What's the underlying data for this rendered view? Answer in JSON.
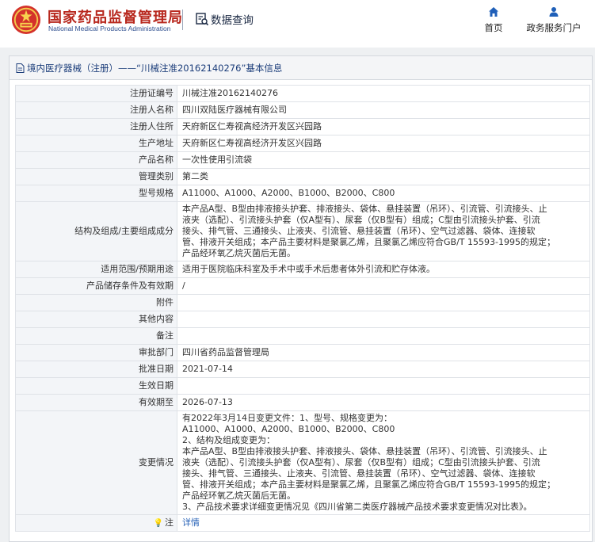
{
  "header": {
    "title_cn": "国家药品监督管理局",
    "title_en": "National Medical Products Administration",
    "data_query": "数据查询",
    "nav": [
      {
        "label": "首页",
        "icon": "home-icon"
      },
      {
        "label": "政务服务门户",
        "icon": "user-icon"
      }
    ]
  },
  "breadcrumb": "境内医疗器械（注册）——“川械注准20162140276”基本信息",
  "rows": {
    "reg_no": {
      "label": "注册证编号",
      "value": "川械注准20162140276"
    },
    "registrant": {
      "label": "注册人名称",
      "value": "四川双陆医疗器械有限公司"
    },
    "registrant_addr": {
      "label": "注册人住所",
      "value": "天府新区仁寿视高经济开发区兴园路"
    },
    "prod_addr": {
      "label": "生产地址",
      "value": "天府新区仁寿视高经济开发区兴园路"
    },
    "product_name": {
      "label": "产品名称",
      "value": "一次性使用引流袋"
    },
    "mgmt_class": {
      "label": "管理类别",
      "value": "第二类"
    },
    "models": {
      "label": "型号规格",
      "value": "A11000、A1000、A2000、B1000、B2000、C800"
    },
    "structure": {
      "label": "结构及组成/主要组成成分",
      "lines": [
        "本产品A型、B型由排液接头护套、排液接头、袋体、悬挂装置（吊环）、引流管、引流接头、止",
        "液夹（选配）、引流接头护套（仅A型有）、尿套（仅B型有）组成；C型由引流接头护套、引流",
        "接头、排气管、三通接头、止液夹、引流管、悬挂装置（吊环）、空气过滤器、袋体、连接软",
        "管、排液开关组成；本产品主要材料是聚氯乙烯，且聚氯乙烯应符合GB/T 15593-1995的规定；",
        "产品经环氧乙烷灭菌后无菌。"
      ]
    },
    "scope": {
      "label": "适用范围/预期用途",
      "value": "适用于医院临床科室及手术中或手术后患者体外引流和贮存体液。"
    },
    "storage": {
      "label": "产品储存条件及有效期",
      "value": "/"
    },
    "attachment": {
      "label": "附件",
      "value": ""
    },
    "other": {
      "label": "其他内容",
      "value": ""
    },
    "remarks": {
      "label": "备注",
      "value": ""
    },
    "approver": {
      "label": "审批部门",
      "value": "四川省药品监督管理局"
    },
    "approval_date": {
      "label": "批准日期",
      "value": "2021-07-14"
    },
    "effective_date": {
      "label": "生效日期",
      "value": ""
    },
    "valid_until": {
      "label": "有效期至",
      "value": "2026-07-13"
    },
    "changes": {
      "label": "变更情况",
      "lines": [
        "有2022年3月14日变更文件：1、型号、规格变更为：",
        "A11000、A1000、A2000、B1000、B2000、C800",
        "2、结构及组成变更为：",
        "本产品A型、B型由排液接头护套、排液接头、袋体、悬挂装置（吊环）、引流管、引流接头、止",
        "液夹（选配）、引流接头护套（仅A型有）、尿套（仅B型有）组成；C型由引流接头护套、引流",
        "接头、排气管、三通接头、止液夹、引流管、悬挂装置（吊环）、空气过滤器、袋体、连接软",
        "管、排液开关组成；本产品主要材料是聚氯乙烯，且聚氯乙烯应符合GB/T 15593-1995的规定；",
        "产品经环氧乙烷灭菌后无菌。",
        "3、产品技术要求详细变更情况见《四川省第二类医疗器械产品技术要求变更情况对比表》。"
      ]
    },
    "note": {
      "label": "注",
      "link": "详情",
      "icon": "lightbulb-icon"
    }
  },
  "colors": {
    "brand_red": "#b8281e",
    "brand_blue": "#2f4f8f",
    "link": "#2a64b8",
    "label_bg": "#f3f5f8"
  }
}
